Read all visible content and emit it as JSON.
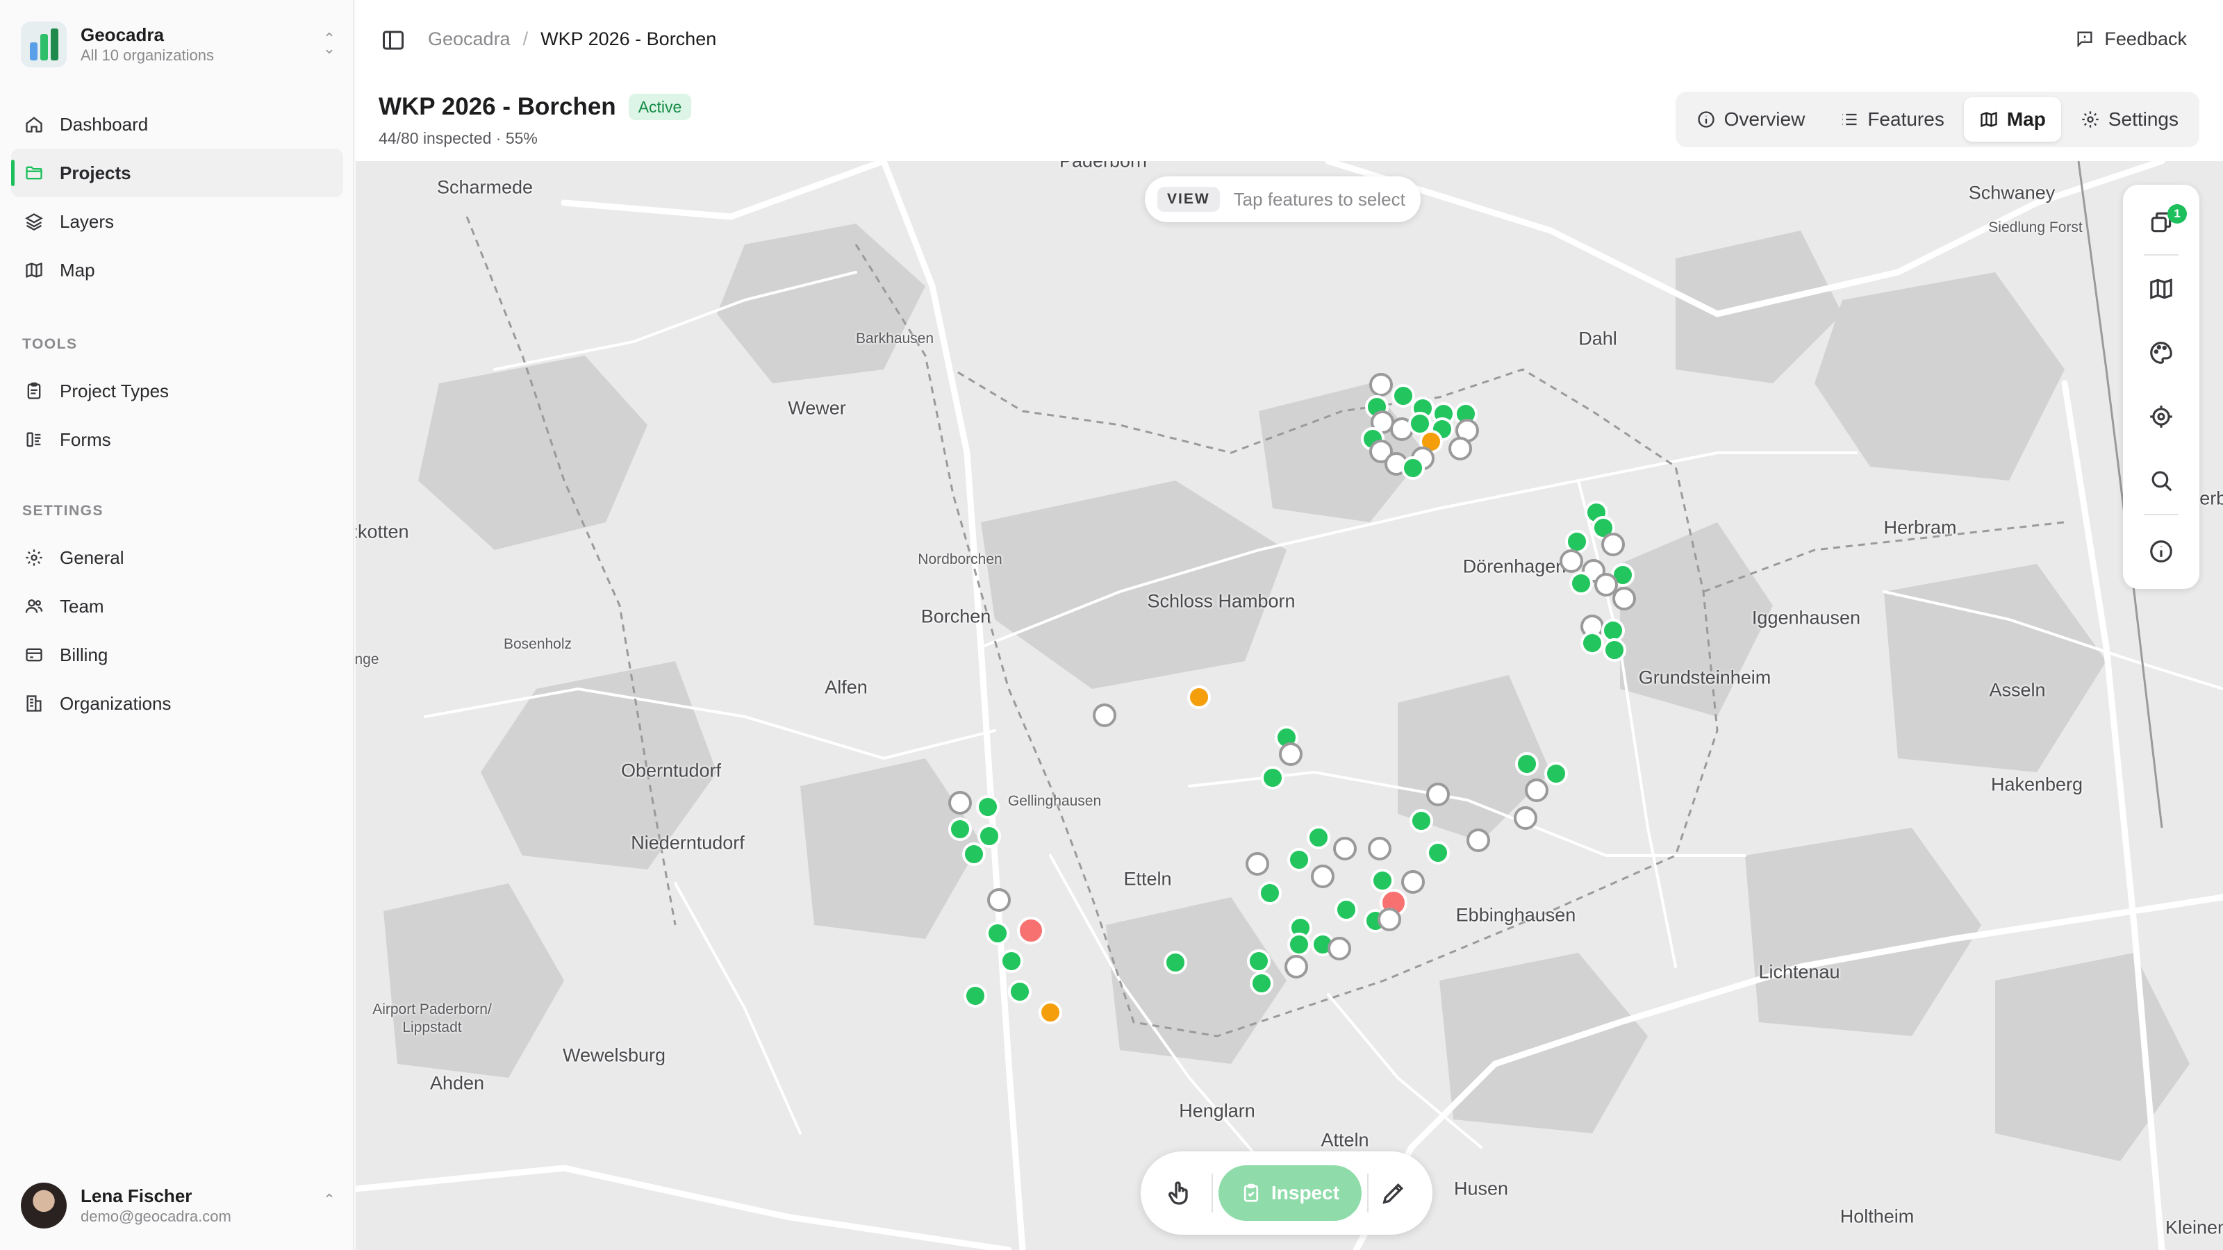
{
  "org": {
    "name": "Geocadra",
    "subtitle": "All 10 organizations",
    "logo_colors": [
      "#5aa0e8",
      "#2fbf6a",
      "#1f8a4c"
    ]
  },
  "nav": {
    "main": [
      {
        "label": "Dashboard",
        "icon": "home-icon",
        "active": false
      },
      {
        "label": "Projects",
        "icon": "folder-icon",
        "active": true
      },
      {
        "label": "Layers",
        "icon": "layers-icon",
        "active": false
      },
      {
        "label": "Map",
        "icon": "map-icon",
        "active": false
      }
    ],
    "tools_label": "TOOLS",
    "tools": [
      {
        "label": "Project Types",
        "icon": "clipboard-icon"
      },
      {
        "label": "Forms",
        "icon": "form-icon"
      }
    ],
    "settings_label": "SETTINGS",
    "settings": [
      {
        "label": "General",
        "icon": "gear-icon"
      },
      {
        "label": "Team",
        "icon": "users-icon"
      },
      {
        "label": "Billing",
        "icon": "credit-card-icon"
      },
      {
        "label": "Organizations",
        "icon": "building-icon"
      }
    ]
  },
  "user": {
    "name": "Lena Fischer",
    "email": "demo@geocadra.com"
  },
  "header": {
    "breadcrumb_root": "Geocadra",
    "breadcrumb_sep": "/",
    "breadcrumb_current": "WKP 2026 - Borchen",
    "feedback": "Feedback",
    "title": "WKP 2026 - Borchen",
    "status": "Active",
    "progress_text": "44/80 inspected · 55%",
    "progress": {
      "inspected": 44,
      "total": 80,
      "percent": 55
    }
  },
  "tabs": [
    {
      "label": "Overview",
      "icon": "info-icon",
      "active": false
    },
    {
      "label": "Features",
      "icon": "list-icon",
      "active": false
    },
    {
      "label": "Map",
      "icon": "map-icon",
      "active": true
    },
    {
      "label": "Settings",
      "icon": "gear-icon",
      "active": false
    }
  ],
  "map": {
    "view_tag": "VIEW",
    "view_hint": "Tap features to select",
    "layer_count": "1",
    "places": [
      "Paderborn",
      "Scharmede",
      "Schwaney",
      "Siedlung Forst",
      "Barkhausen",
      "Wewer",
      "Dahl",
      "lzkotten",
      "Nordborchen",
      "Borchen",
      "Schloss Hamborn",
      "Dörenhagen",
      "Herbram",
      "Herb",
      "Iggenhausen",
      "Bosenholz",
      "nge",
      "Alfen",
      "Grundsteinheim",
      "Asseln",
      "Oberntudorf",
      "Gellinghausen",
      "Hakenberg",
      "Niederntudorf",
      "Etteln",
      "Ebbinghausen",
      "Airport Paderborn/",
      "Lippstadt",
      "Lichtenau",
      "Wewelsburg",
      "Ahden",
      "Henglarn",
      "Atteln",
      "Husen",
      "Holtheim",
      "Kleinen"
    ],
    "legend_colors": {
      "inspected": "#22c55e",
      "pending": "#ffffff",
      "warning": "#f59e0b",
      "issue": "#f87171"
    }
  },
  "toolbar": {
    "inspect_label": "Inspect"
  }
}
